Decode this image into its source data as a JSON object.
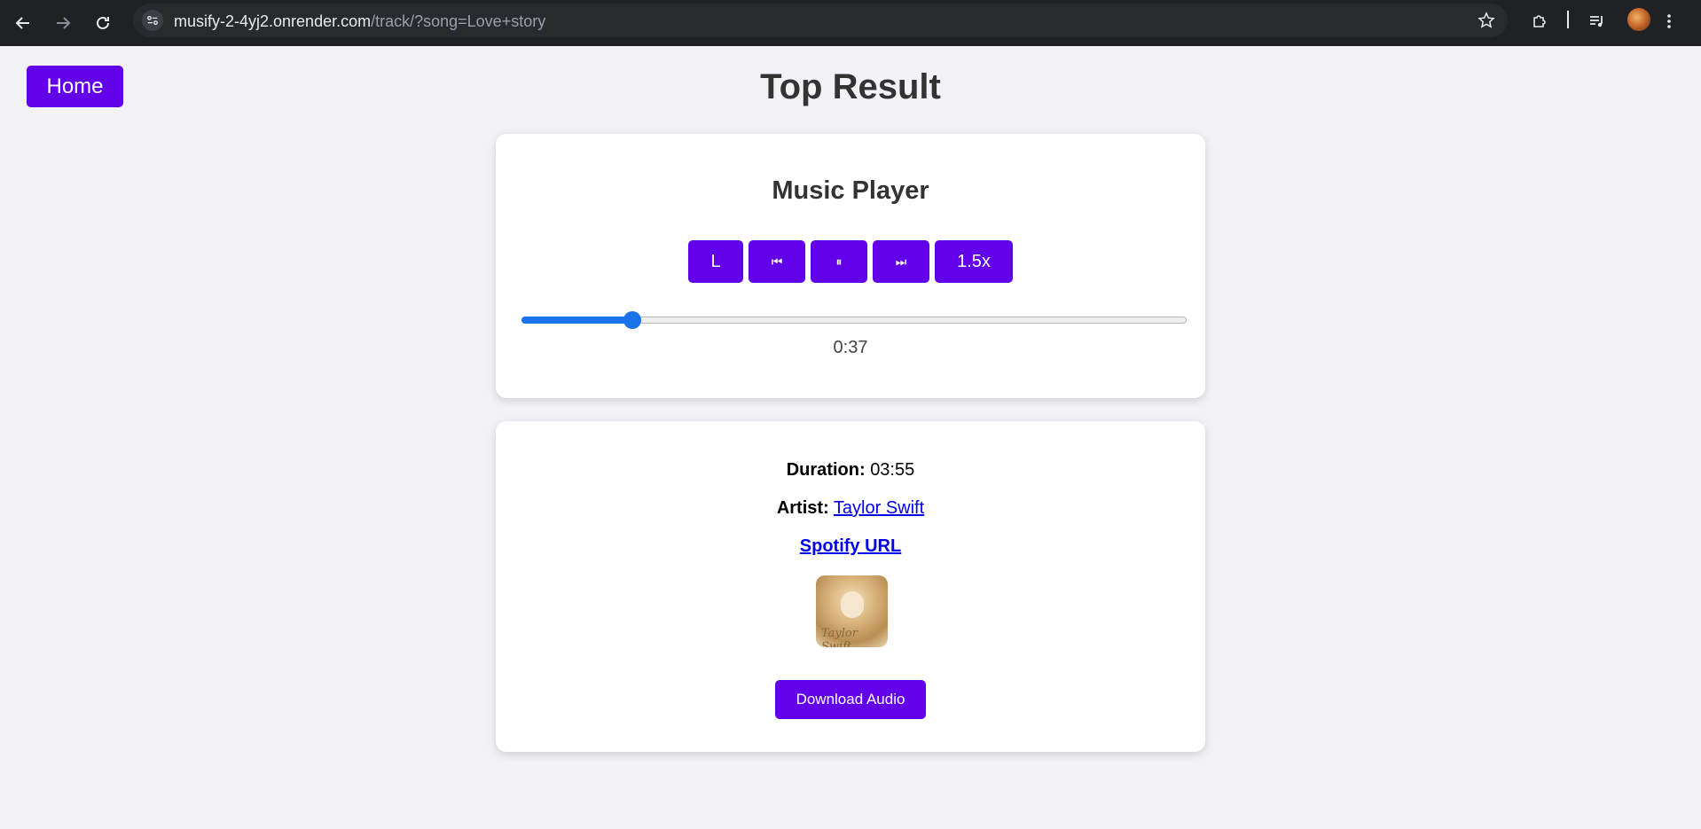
{
  "browser": {
    "url_host": "musify-2-4yj2.onrender.com",
    "url_path": "/track/?song=Love+story"
  },
  "page": {
    "home_label": "Home",
    "title": "Top Result"
  },
  "player": {
    "title": "Music Player",
    "controls": {
      "loop_label": "L",
      "prev_symbol": "⏮",
      "pause_symbol": "⏸",
      "next_symbol": "⏭",
      "speed_label": "1.5x"
    },
    "progress_fraction": 0.167,
    "current_time": "0:37"
  },
  "track": {
    "duration_label": "Duration:",
    "duration": "03:55",
    "artist_label": "Artist:",
    "artist": "Taylor Swift",
    "spotify_link": "Spotify URL",
    "album_art_caption": "Taylor Swift",
    "download_label": "Download Audio"
  },
  "colors": {
    "accent": "#6200ea",
    "slider": "#1a73e8",
    "link": "#0000ee"
  }
}
